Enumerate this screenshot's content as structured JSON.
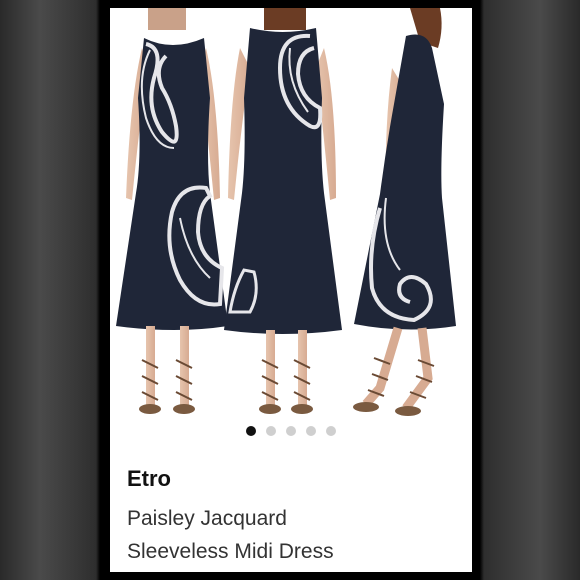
{
  "product": {
    "brand": "Etro",
    "title_line1": "Paisley Jacquard",
    "title_line2": "Sleeveless Midi Dress"
  },
  "gallery": {
    "image_count": 5,
    "active_index": 0,
    "views": [
      "front-view",
      "back-view",
      "side-view"
    ]
  },
  "colors": {
    "dress": "#1f2638",
    "paisley": "#e6e6ea",
    "active_dot": "#111111",
    "inactive_dot": "#cfcfcf"
  }
}
